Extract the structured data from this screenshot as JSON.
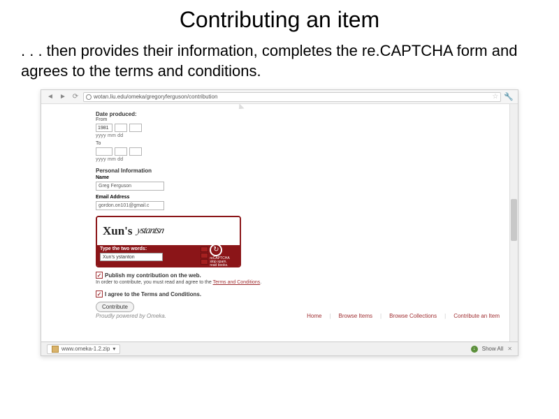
{
  "slide": {
    "title": "Contributing an item",
    "body": ". . . then provides their information, completes the re.CAPTCHA form and agrees to the terms and conditions."
  },
  "browser": {
    "url": "wotan.liu.edu/omeka/gregoryferguson/contribution",
    "download_file": "www.omeka-1.2.zip",
    "show_all": "Show All"
  },
  "form": {
    "date_label": "Date produced:",
    "from": "From",
    "to": "To",
    "yyyy": "1981",
    "hint": "yyyy mm dd",
    "personal_header": "Personal Information",
    "name_label": "Name",
    "name_value": "Greg Ferguson",
    "email_label": "Email Address",
    "email_value": "gordon.on101@gmail.c"
  },
  "captcha": {
    "word1": "Xun's",
    "word2": "ystantsn",
    "prompt": "Type the two words:",
    "input_value": "Xun's ystanton",
    "brand": "reCAPTCHA",
    "tag1": "stop spam.",
    "tag2": "read books."
  },
  "consent": {
    "publish": "Publish my contribution on the web.",
    "must_agree": "In order to contribute, you must read and agree to the ",
    "terms_link": "Terms and Conditions",
    "agree": "I agree to the Terms and Conditions.",
    "button": "Contribute"
  },
  "footer": {
    "powered": "Proudly powered by Omeka.",
    "links": [
      "Home",
      "Browse Items",
      "Browse Collections",
      "Contribute an Item"
    ]
  }
}
